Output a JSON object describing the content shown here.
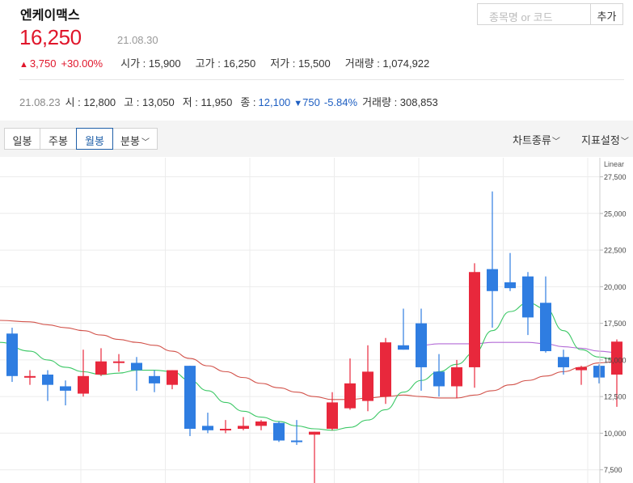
{
  "header": {
    "name": "엔케이맥스",
    "price": "16,250",
    "date": "21.08.30",
    "search_placeholder": "종목명 or 코드",
    "add_label": "추가"
  },
  "summary": {
    "change": "3,750",
    "change_pct": "+30.00%",
    "open": "시가 : 15,900",
    "high": "고가 : 16,250",
    "low": "저가 : 15,500",
    "volume": "거래량 : 1,074,922"
  },
  "history": {
    "date": "21.08.23",
    "open": "시 : 12,800",
    "high": "고 : 13,050",
    "low": "저 : 11,950",
    "close_label": "종 :",
    "close": "12,100",
    "change": "750",
    "change_pct": "-5.84%",
    "volume": "거래량 : 308,853"
  },
  "tabs": [
    "일봉",
    "주봉",
    "월봉",
    "분봉"
  ],
  "tools": [
    "차트종류",
    "지표설정"
  ],
  "colors": {
    "up": "#e8283c",
    "down": "#2f7de1",
    "ma_green": "#3cc866",
    "ma_red": "#d2524a",
    "ma_purple": "#b36bd6"
  },
  "chart_data": {
    "type": "candlestick",
    "scale_label": "Linear",
    "ylim": [
      6600,
      28800
    ],
    "yticks": [
      "27,500",
      "25,000",
      "22,500",
      "20,000",
      "17,500",
      "15,000",
      "12,500",
      "10,000",
      "7,500"
    ],
    "candles": [
      {
        "o": 16800,
        "h": 17200,
        "l": 13500,
        "c": 13900
      },
      {
        "o": 13850,
        "h": 14300,
        "l": 13300,
        "c": 13900
      },
      {
        "o": 14000,
        "h": 14300,
        "l": 12200,
        "c": 13300
      },
      {
        "o": 13200,
        "h": 13600,
        "l": 11900,
        "c": 12900
      },
      {
        "o": 12700,
        "h": 15700,
        "l": 12500,
        "c": 13900
      },
      {
        "o": 14000,
        "h": 15800,
        "l": 13900,
        "c": 14900
      },
      {
        "o": 14900,
        "h": 15400,
        "l": 14200,
        "c": 14900
      },
      {
        "o": 14800,
        "h": 15200,
        "l": 12900,
        "c": 14300
      },
      {
        "o": 13900,
        "h": 14300,
        "l": 12800,
        "c": 13400
      },
      {
        "o": 13300,
        "h": 14300,
        "l": 13000,
        "c": 14300
      },
      {
        "o": 14600,
        "h": 14600,
        "l": 9800,
        "c": 10300
      },
      {
        "o": 10500,
        "h": 11400,
        "l": 10000,
        "c": 10200
      },
      {
        "o": 10300,
        "h": 10900,
        "l": 10000,
        "c": 10300
      },
      {
        "o": 10300,
        "h": 11100,
        "l": 10200,
        "c": 10500
      },
      {
        "o": 10500,
        "h": 10900,
        "l": 10200,
        "c": 10800
      },
      {
        "o": 10700,
        "h": 10800,
        "l": 9400,
        "c": 9500
      },
      {
        "o": 9500,
        "h": 10900,
        "l": 9200,
        "c": 9400
      },
      {
        "o": 9900,
        "h": 10100,
        "l": 6400,
        "c": 10100
      },
      {
        "o": 10300,
        "h": 12800,
        "l": 10200,
        "c": 12100
      },
      {
        "o": 11700,
        "h": 15100,
        "l": 11600,
        "c": 13400
      },
      {
        "o": 12200,
        "h": 16000,
        "l": 11500,
        "c": 14200
      },
      {
        "o": 12500,
        "h": 16500,
        "l": 12000,
        "c": 16200
      },
      {
        "o": 16000,
        "h": 18500,
        "l": 15700,
        "c": 15700
      },
      {
        "o": 17500,
        "h": 18500,
        "l": 12900,
        "c": 14500
      },
      {
        "o": 14200,
        "h": 15400,
        "l": 12500,
        "c": 13200
      },
      {
        "o": 13200,
        "h": 15000,
        "l": 12400,
        "c": 14500
      },
      {
        "o": 14500,
        "h": 21600,
        "l": 13100,
        "c": 21000
      },
      {
        "o": 21200,
        "h": 26500,
        "l": 17200,
        "c": 19700
      },
      {
        "o": 20300,
        "h": 22300,
        "l": 19700,
        "c": 19900
      },
      {
        "o": 20700,
        "h": 21000,
        "l": 16700,
        "c": 17900
      },
      {
        "o": 18900,
        "h": 20700,
        "l": 15500,
        "c": 15600
      },
      {
        "o": 15200,
        "h": 15700,
        "l": 14000,
        "c": 14500
      },
      {
        "o": 14300,
        "h": 14600,
        "l": 13300,
        "c": 14500
      },
      {
        "o": 14600,
        "h": 14700,
        "l": 13400,
        "c": 13800
      },
      {
        "o": 14000,
        "h": 16400,
        "l": 11800,
        "c": 16250
      }
    ],
    "ma_green": [
      16200,
      15600,
      15000,
      14500,
      14200,
      14000,
      14100,
      14300,
      14300,
      14200,
      13600,
      12900,
      12100,
      11500,
      11100,
      10800,
      10500,
      10300,
      10200,
      10400,
      10900,
      11600,
      12800,
      13600,
      14200,
      14700,
      15500,
      17000,
      18300,
      18900,
      18500,
      17000,
      15700,
      15200,
      15000
    ],
    "ma_red": [
      17700,
      17600,
      17400,
      17200,
      17000,
      16700,
      16400,
      16200,
      16000,
      15600,
      15100,
      14600,
      14200,
      13800,
      13400,
      13100,
      12800,
      12500,
      12300,
      12300,
      12400,
      12500,
      12600,
      12500,
      12400,
      12400,
      12600,
      12900,
      13300,
      13600,
      13900,
      14200,
      14500,
      14800,
      14900
    ],
    "ma_purple": [
      null,
      null,
      null,
      null,
      null,
      null,
      null,
      null,
      null,
      null,
      null,
      null,
      null,
      null,
      null,
      null,
      null,
      null,
      null,
      null,
      null,
      null,
      null,
      16000,
      16100,
      16100,
      16100,
      16200,
      16200,
      16200,
      16100,
      15900,
      15800,
      15600,
      15500
    ]
  }
}
